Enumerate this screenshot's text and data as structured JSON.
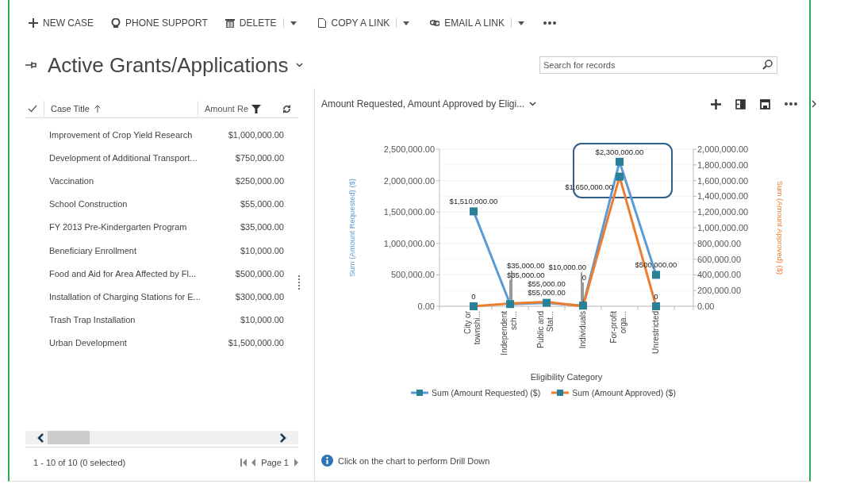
{
  "toolbar": [
    {
      "label": "NEW CASE",
      "has_menu": false
    },
    {
      "label": "PHONE SUPPORT",
      "has_menu": false
    },
    {
      "label": "DELETE",
      "has_menu": true
    },
    {
      "label": "COPY A LINK",
      "has_menu": true
    },
    {
      "label": "EMAIL A LINK",
      "has_menu": true
    }
  ],
  "view": {
    "title": "Active Grants/Applications"
  },
  "search": {
    "placeholder": "Search for records"
  },
  "grid": {
    "columns": [
      "Case Title",
      "Amount Re"
    ],
    "rows": [
      {
        "title": "Improvement of Crop Yield Research",
        "amount": "$1,000,000.00",
        "selected": false
      },
      {
        "title": "Development of Additional Transport...",
        "amount": "$750,000.00",
        "selected": false
      },
      {
        "title": "Vaccination",
        "amount": "$250,000.00",
        "selected": false
      },
      {
        "title": "School Construction",
        "amount": "$55,000.00",
        "selected": false
      },
      {
        "title": "FY 2013 Pre-Kindergarten Program",
        "amount": "$35,000.00",
        "selected": false
      },
      {
        "title": "Beneficiary Enrollment",
        "amount": "$10,000.00",
        "selected": false
      },
      {
        "title": "Food and Aid for Area Affected by Fl...",
        "amount": "$500,000.00",
        "selected": false
      },
      {
        "title": "Installation of Charging Stations for E...",
        "amount": "$300,000.00",
        "selected": false
      },
      {
        "title": "Trash Trap Installation",
        "amount": "$10,000.00",
        "selected": false
      },
      {
        "title": "Urban Development",
        "amount": "$1,500,000.00",
        "selected": false
      }
    ],
    "status": "1 - 10 of 10 (0 selected)",
    "page": "Page 1"
  },
  "chart": {
    "title": "Amount Requested, Amount Approved by Eligi...",
    "hint": "Click on the chart to perform Drill Down",
    "chart_data": {
      "type": "line",
      "xlabel": "Eligibility Category",
      "ylabel": "Sum (Amount Requested) ($)",
      "y2label": "Sum (Amount Approved) ($)",
      "grid": true,
      "categories": [
        "City or townshi...",
        "Independent sch...",
        "Public and Stat...",
        "Individuals",
        "For-profit orga...",
        "Unrestricted"
      ],
      "ylim": [
        0,
        2500000
      ],
      "y2lim": [
        0,
        2000000
      ],
      "yticks": [
        {
          "value": 0,
          "label": "0.00"
        },
        {
          "value": 500000,
          "label": "500,000.00"
        },
        {
          "value": 1000000,
          "label": "1,000,000.00"
        },
        {
          "value": 1500000,
          "label": "1,500,000.00"
        },
        {
          "value": 2000000,
          "label": "2,000,000.00"
        },
        {
          "value": 2500000,
          "label": "2,500,000.00"
        }
      ],
      "y2ticks": [
        {
          "value": 0,
          "label": "0.00"
        },
        {
          "value": 200000,
          "label": "200,000.00"
        },
        {
          "value": 400000,
          "label": "400,000.00"
        },
        {
          "value": 600000,
          "label": "600,000.00"
        },
        {
          "value": 800000,
          "label": "800,000.00"
        },
        {
          "value": 1000000,
          "label": "1,000,000.00"
        },
        {
          "value": 1200000,
          "label": "1,200,000.00"
        },
        {
          "value": 1400000,
          "label": "1,400,000.00"
        },
        {
          "value": 1600000,
          "label": "1,600,000.00"
        },
        {
          "value": 1800000,
          "label": "1,800,000.00"
        },
        {
          "value": 2000000,
          "label": "2,000,000.00"
        }
      ],
      "series": [
        {
          "name": "Sum (Amount Requested) ($)",
          "color": "#5b9bd5",
          "marker": "square",
          "values": [
            1510000,
            35000,
            55000,
            10000,
            2300000,
            500000
          ],
          "value_labels": [
            "$1,510,000.00",
            "$35,000.00",
            "$55,000.00",
            "$10,000.00",
            "$2,300,000.00",
            "$500,000.00"
          ]
        },
        {
          "name": "Sum (Amount Approved) ($)",
          "color": "#ed7d31",
          "axis": "y2",
          "marker": "square",
          "values": [
            0,
            35000,
            55000,
            0,
            1650000,
            0
          ],
          "value_labels": [
            "0",
            "$35,000.00",
            "$55,000.00",
            "0",
            "$1,650,000.00",
            "0"
          ]
        }
      ]
    },
    "highlight_box": [
      false,
      false,
      false,
      false,
      true,
      false
    ]
  }
}
